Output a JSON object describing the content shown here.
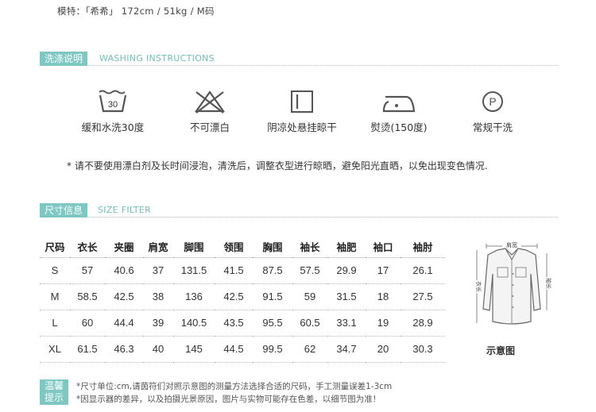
{
  "model_info": "模特：「希希」 172cm / 51kg / M码",
  "washing": {
    "title": "洗涤说明",
    "subtitle": "WASHING INSTRUCTIONS",
    "icons": [
      {
        "icon": "wash-30-icon",
        "number": "30",
        "label": "缓和水洗30度"
      },
      {
        "icon": "no-bleach-icon",
        "label": "不可漂白"
      },
      {
        "icon": "shade-hang-dry-icon",
        "label": "阴凉处悬挂晾干"
      },
      {
        "icon": "iron-icon",
        "label": "熨烫(150度)"
      },
      {
        "icon": "dry-clean-p-icon",
        "letter": "P",
        "label": "常规干洗"
      }
    ],
    "note": "* 请不要使用漂白剂及长时间浸泡，清洗后，调整衣型进行晾晒，避免阳光直晒，以免出现变色情况."
  },
  "size": {
    "title": "尺寸信息",
    "subtitle": "SIZE FILTER",
    "headers": [
      "尺码",
      "衣长",
      "夹圈",
      "肩宽",
      "脚围",
      "领围",
      "胸围",
      "袖长",
      "袖肥",
      "袖口",
      "袖肘"
    ],
    "rows": [
      [
        "S",
        "57",
        "40.6",
        "37",
        "131.5",
        "41.5",
        "87.5",
        "57.5",
        "29.9",
        "17",
        "26.1"
      ],
      [
        "M",
        "58.5",
        "42.5",
        "38",
        "136",
        "42.5",
        "91.5",
        "59",
        "31.5",
        "18",
        "27.5"
      ],
      [
        "L",
        "60",
        "44.4",
        "39",
        "140.5",
        "43.5",
        "95.5",
        "60.5",
        "33.1",
        "19",
        "28.9"
      ],
      [
        "XL",
        "61.5",
        "46.3",
        "40",
        "145",
        "44.5",
        "99.5",
        "62",
        "34.7",
        "20",
        "30.3"
      ]
    ],
    "diagram": {
      "shoulder_label": "肩宽",
      "left_label": "衣长",
      "right_label": "袖长",
      "caption": "示意图"
    }
  },
  "tips": {
    "badge_line1": "温馨",
    "badge_line2": "提示",
    "line1": "*尺寸单位:cm,请茵符们对照示意图的测量方法选择合适的尺码，手工测量误差1-3cm",
    "line2": "*因显示器的差异，以及拍摄光景原因，图片与实物可能存在色差，以细节图为准！"
  },
  "colors": {
    "accent": "#7ec8c4",
    "accent_text": "#6fbfbb",
    "icon_stroke": "#555555"
  }
}
